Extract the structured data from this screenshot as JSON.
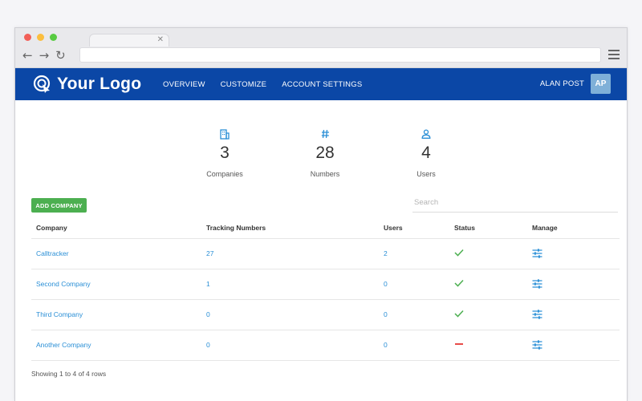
{
  "colors": {
    "brand": "#0b47a6",
    "link": "#2a8fd6",
    "success": "#4caf50",
    "danger": "#e53935"
  },
  "app": {
    "logo_text": "Your Logo",
    "nav": [
      "OVERVIEW",
      "CUSTOMIZE",
      "ACCOUNT SETTINGS"
    ],
    "user_name": "ALAN POST",
    "avatar_initials": "AP"
  },
  "stats": [
    {
      "icon": "building-icon",
      "value": "3",
      "label": "Companies"
    },
    {
      "icon": "hash-icon",
      "value": "28",
      "label": "Numbers"
    },
    {
      "icon": "user-icon",
      "value": "4",
      "label": "Users"
    }
  ],
  "toolbar": {
    "add_label": "ADD COMPANY",
    "search_placeholder": "Search"
  },
  "table": {
    "headers": [
      "Company",
      "Tracking Numbers",
      "Users",
      "Status",
      "Manage"
    ],
    "rows": [
      {
        "company": "Calltracker",
        "tracking": "27",
        "users": "2",
        "status": "active"
      },
      {
        "company": "Second Company",
        "tracking": "1",
        "users": "0",
        "status": "active"
      },
      {
        "company": "Third Company",
        "tracking": "0",
        "users": "0",
        "status": "active"
      },
      {
        "company": "Another Company",
        "tracking": "0",
        "users": "0",
        "status": "inactive"
      }
    ]
  },
  "footer": {
    "rows_text": "Showing 1 to 4 of 4 rows"
  }
}
